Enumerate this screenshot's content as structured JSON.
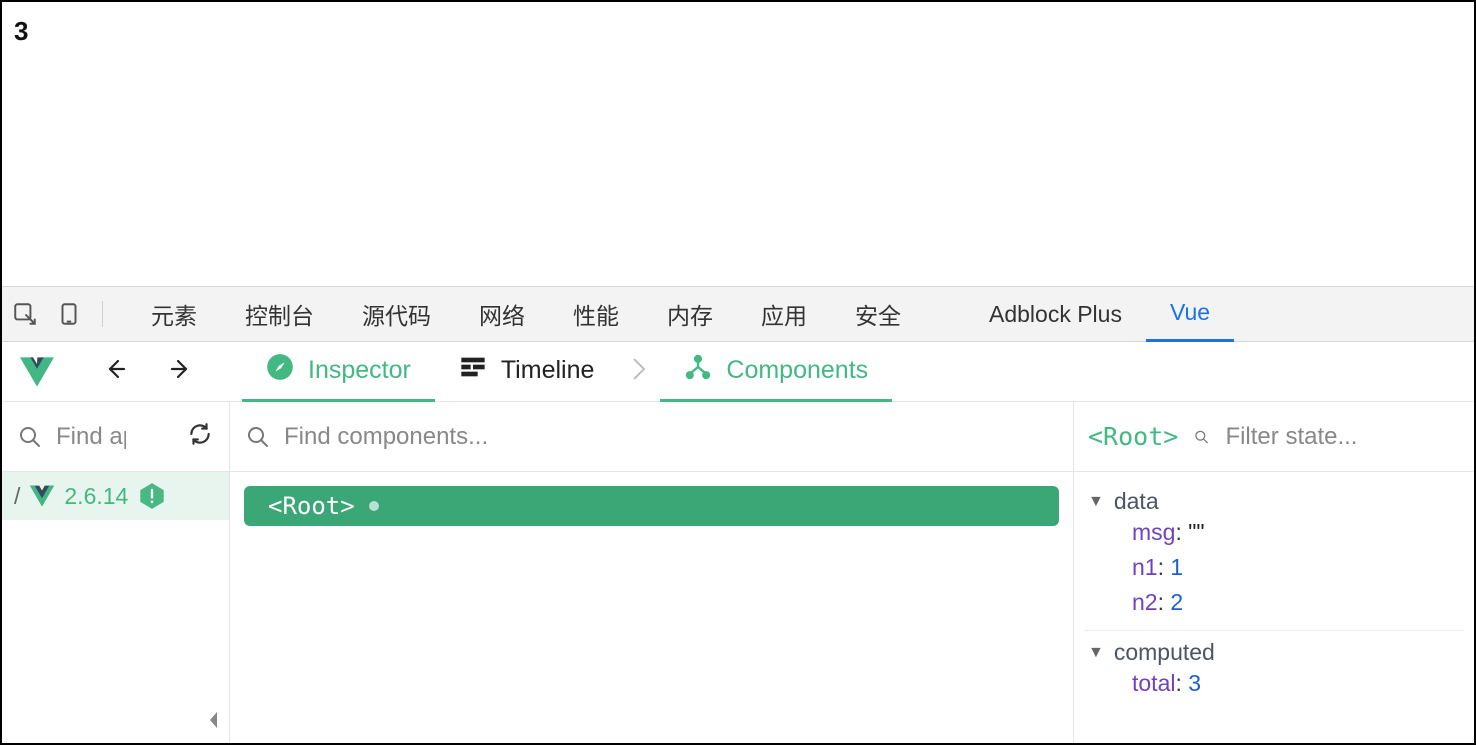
{
  "page": {
    "output": "3"
  },
  "devtools_tabs": {
    "items": [
      "元素",
      "控制台",
      "源代码",
      "网络",
      "性能",
      "内存",
      "应用",
      "安全"
    ],
    "extra": [
      "Adblock Plus",
      "Vue"
    ],
    "active": "Vue"
  },
  "vue_tabs": {
    "inspector": "Inspector",
    "timeline": "Timeline",
    "components": "Components"
  },
  "apps_panel": {
    "search_placeholder": "Find apps...",
    "selected": {
      "version": "2.6.14"
    }
  },
  "tree_panel": {
    "search_placeholder": "Find components...",
    "root_label": "<Root>"
  },
  "state_panel": {
    "title": "<Root>",
    "filter_placeholder": "Filter state...",
    "sections": {
      "data": {
        "label": "data",
        "entries": [
          {
            "key": "msg",
            "value": "\"\"",
            "type": "string"
          },
          {
            "key": "n1",
            "value": "1",
            "type": "number"
          },
          {
            "key": "n2",
            "value": "2",
            "type": "number"
          }
        ]
      },
      "computed": {
        "label": "computed",
        "entries": [
          {
            "key": "total",
            "value": "3",
            "type": "number"
          }
        ]
      }
    }
  }
}
